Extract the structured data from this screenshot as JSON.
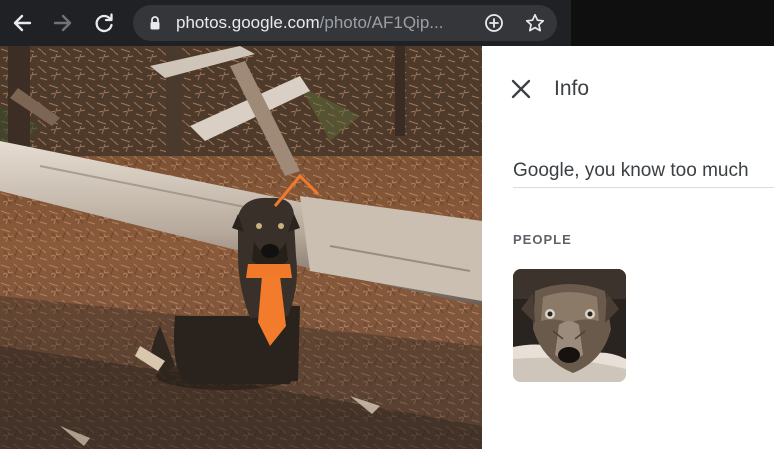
{
  "browser": {
    "url_host": "photos.google.com",
    "url_path": "/photo/AF1Qip..."
  },
  "info_panel": {
    "title": "Info",
    "description": "Google, you know too much",
    "people_heading": "PEOPLE"
  },
  "icons": {
    "back": "arrow-left",
    "forward": "arrow-right",
    "reload": "reload",
    "lock": "lock",
    "add_to_page": "plus-circle",
    "bookmark": "star",
    "close": "x"
  },
  "colors": {
    "toolbar": "#202124",
    "omnibox": "#35363a",
    "url_host": "#e8eaed",
    "url_path": "#9aa0a6",
    "panel_bg": "#ffffff",
    "panel_text": "#3c4043",
    "muted_text": "#5f6368",
    "divider": "#dadce0"
  }
}
